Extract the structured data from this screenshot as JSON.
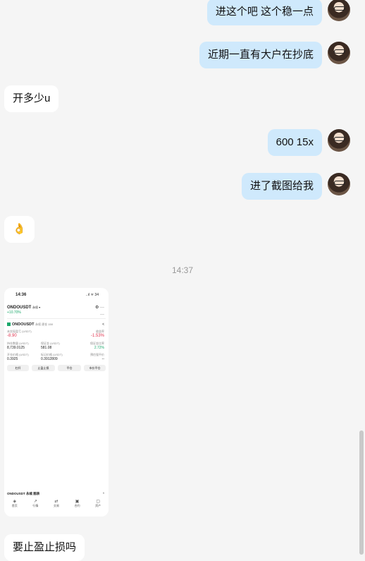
{
  "messages": [
    {
      "side": "mine",
      "text": "进这个吧  这个稳一点"
    },
    {
      "side": "mine",
      "text": "近期一直有大户在抄底"
    },
    {
      "side": "theirs",
      "text": "开多少u"
    },
    {
      "side": "mine",
      "text": "600  15x"
    },
    {
      "side": "mine",
      "text": "进了截图给我"
    },
    {
      "side": "theirs",
      "text": "👌"
    },
    {
      "side": "theirs",
      "text": "要止盈止损吗"
    }
  ],
  "timestamp": "14:37",
  "screenshot": {
    "status_time": "14:36",
    "status_right": "..ıl ᯤ 34",
    "pair": "ONDOUSDT",
    "pair_suffix": "永续 ▾",
    "pct": "+10.70%",
    "header_icons": "⚙ ···",
    "more": "···",
    "symbol": "ONDOUSDT",
    "symbol_tags": "永续  逐仓 15X",
    "share": "<",
    "unrealized_label": "未实现盈亏 (USDT)",
    "unrealized_value": "-8.90",
    "roi_label": "收益率",
    "roi_value": "-1.53%",
    "size_label": "持仓数量 (USDT)",
    "size_value": "8,739.0125",
    "margin_label": "保证金 (USDT)",
    "margin_value": "581.08",
    "ratio_label": "保证金比率",
    "ratio_value": "2.72%",
    "entry_label": "开仓价格 (USDT)",
    "entry_value": "0.3925",
    "mark_label": "标记价格 (USDT)",
    "mark_value": "0.3912809",
    "liq_label": "预估强平价",
    "liq_value": "--",
    "buttons": [
      "杠杆",
      "止盈止损",
      "平仓",
      "市价平仓"
    ],
    "bottom_title": "ONDOUSDT 永续 图表",
    "bottom_caret": "^",
    "nav": [
      {
        "icon": "◈",
        "label": "首页"
      },
      {
        "icon": "↗",
        "label": "行情"
      },
      {
        "icon": "⇄",
        "label": "交易"
      },
      {
        "icon": "▣",
        "label": "合约"
      },
      {
        "icon": "▢",
        "label": "资产"
      }
    ]
  }
}
